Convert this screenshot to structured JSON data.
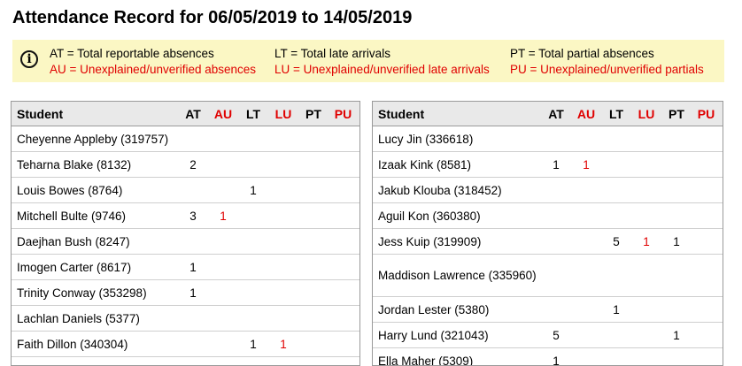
{
  "title": "Attendance Record for 06/05/2019 to 14/05/2019",
  "legend": {
    "icon": "info-icon",
    "at": "AT = Total reportable absences",
    "au": "AU = Unexplained/unverified absences",
    "lt": "LT = Total late arrivals",
    "lu": "LU = Unexplained/unverified late arrivals",
    "pt": "PT = Total partial absences",
    "pu": "PU = Unexplained/unverified partials"
  },
  "columns": {
    "student": "Student",
    "at": "AT",
    "au": "AU",
    "lt": "LT",
    "lu": "LU",
    "pt": "PT",
    "pu": "PU"
  },
  "left_rows": [
    {
      "name": "Cheyenne Appleby (319757)",
      "at": "",
      "au": "",
      "lt": "",
      "lu": "",
      "pt": "",
      "pu": ""
    },
    {
      "name": "Teharna Blake (8132)",
      "at": "2",
      "au": "",
      "lt": "",
      "lu": "",
      "pt": "",
      "pu": ""
    },
    {
      "name": "Louis Bowes (8764)",
      "at": "",
      "au": "",
      "lt": "1",
      "lu": "",
      "pt": "",
      "pu": ""
    },
    {
      "name": "Mitchell Bulte (9746)",
      "at": "3",
      "au": "1",
      "lt": "",
      "lu": "",
      "pt": "",
      "pu": ""
    },
    {
      "name": "Daejhan Bush (8247)",
      "at": "",
      "au": "",
      "lt": "",
      "lu": "",
      "pt": "",
      "pu": ""
    },
    {
      "name": "Imogen Carter (8617)",
      "at": "1",
      "au": "",
      "lt": "",
      "lu": "",
      "pt": "",
      "pu": ""
    },
    {
      "name": "Trinity Conway (353298)",
      "at": "1",
      "au": "",
      "lt": "",
      "lu": "",
      "pt": "",
      "pu": ""
    },
    {
      "name": "Lachlan Daniels (5377)",
      "at": "",
      "au": "",
      "lt": "",
      "lu": "",
      "pt": "",
      "pu": ""
    },
    {
      "name": "Faith Dillon (340304)",
      "at": "",
      "au": "",
      "lt": "1",
      "lu": "1",
      "pt": "",
      "pu": ""
    }
  ],
  "right_rows": [
    {
      "name": "Lucy Jin (336618)",
      "at": "",
      "au": "",
      "lt": "",
      "lu": "",
      "pt": "",
      "pu": ""
    },
    {
      "name": "Izaak Kink (8581)",
      "at": "1",
      "au": "1",
      "lt": "",
      "lu": "",
      "pt": "",
      "pu": ""
    },
    {
      "name": "Jakub Klouba (318452)",
      "at": "",
      "au": "",
      "lt": "",
      "lu": "",
      "pt": "",
      "pu": ""
    },
    {
      "name": "Aguil Kon (360380)",
      "at": "",
      "au": "",
      "lt": "",
      "lu": "",
      "pt": "",
      "pu": ""
    },
    {
      "name": "Jess Kuip (319909)",
      "at": "",
      "au": "",
      "lt": "5",
      "lu": "1",
      "pt": "1",
      "pu": ""
    },
    {
      "name": "Maddison Lawrence (335960)",
      "at": "",
      "au": "",
      "lt": "",
      "lu": "",
      "pt": "",
      "pu": ""
    },
    {
      "name": "Jordan Lester (5380)",
      "at": "",
      "au": "",
      "lt": "1",
      "lu": "",
      "pt": "",
      "pu": ""
    },
    {
      "name": "Harry Lund (321043)",
      "at": "5",
      "au": "",
      "lt": "",
      "lu": "",
      "pt": "1",
      "pu": ""
    },
    {
      "name": "Ella Maher (5309)",
      "at": "1",
      "au": "",
      "lt": "",
      "lu": "",
      "pt": "",
      "pu": ""
    }
  ],
  "colors": {
    "unexplained": "#e00000",
    "legend_bg": "#fbf7c4",
    "header_bg": "#e9e9e9"
  }
}
